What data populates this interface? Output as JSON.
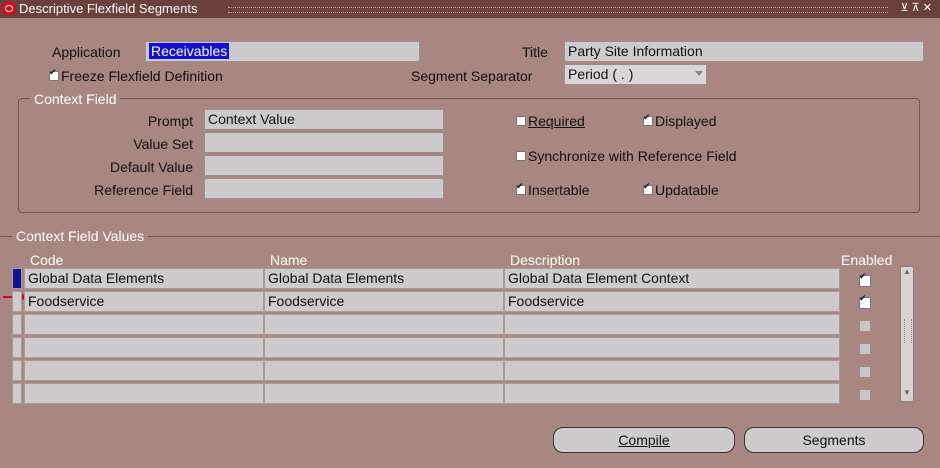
{
  "window": {
    "title": "Descriptive Flexfield Segments"
  },
  "header": {
    "application_label": "Application",
    "application_value": "Receivables",
    "title_label": "Title",
    "title_value": "Party Site Information",
    "freeze_label": "Freeze Flexfield Definition",
    "freeze_checked": true,
    "separator_label": "Segment Separator",
    "separator_value": "Period ( . )"
  },
  "context_field": {
    "group_title": "Context Field",
    "prompt_label": "Prompt",
    "prompt_value": "Context Value",
    "value_set_label": "Value Set",
    "value_set_value": "",
    "default_value_label": "Default Value",
    "default_value_value": "",
    "reference_field_label": "Reference Field",
    "reference_field_value": "",
    "required_label": "Required",
    "required_checked": false,
    "displayed_label": "Displayed",
    "displayed_checked": true,
    "sync_label": "Synchronize with Reference Field",
    "sync_checked": false,
    "insertable_label": "Insertable",
    "insertable_checked": true,
    "updatable_label": "Updatable",
    "updatable_checked": true
  },
  "values": {
    "group_title": "Context Field Values",
    "columns": {
      "code": "Code",
      "name": "Name",
      "description": "Description",
      "enabled": "Enabled"
    },
    "rows": [
      {
        "code": "Global Data Elements",
        "name": "Global Data Elements",
        "description": "Global Data Element Context",
        "enabled": true
      },
      {
        "code": "Foodservice",
        "name": "Foodservice",
        "description": "Foodservice",
        "enabled": true
      },
      {
        "code": "",
        "name": "",
        "description": "",
        "enabled": false
      },
      {
        "code": "",
        "name": "",
        "description": "",
        "enabled": false
      },
      {
        "code": "",
        "name": "",
        "description": "",
        "enabled": false
      },
      {
        "code": "",
        "name": "",
        "description": "",
        "enabled": false
      }
    ]
  },
  "buttons": {
    "compile": "Compile",
    "segments": "Segments"
  }
}
